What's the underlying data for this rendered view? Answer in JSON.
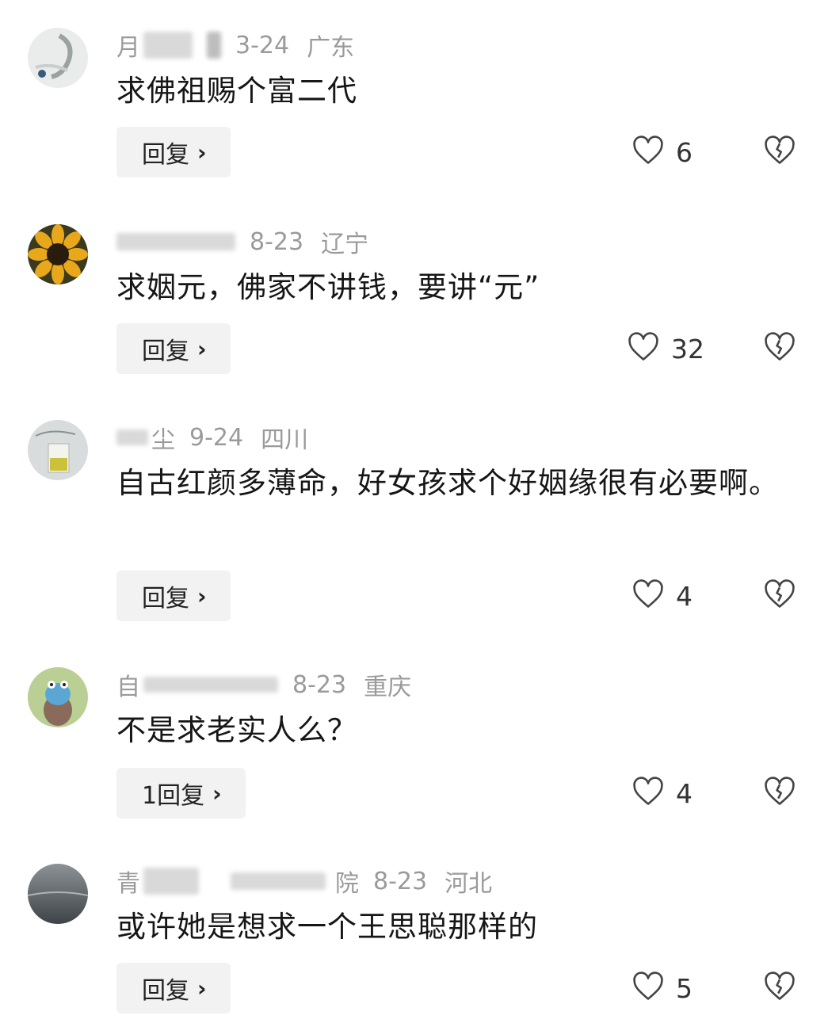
{
  "comments": [
    {
      "username": "月",
      "date": "3-24",
      "location": "广东",
      "text": "求佛祖赐个富二代",
      "reply_label": "回复",
      "likes": "6"
    },
    {
      "username": "",
      "date": "8-23",
      "location": "辽宁",
      "text": "求姻元，佛家不讲钱，要讲“元”",
      "reply_label": "回复",
      "likes": "32"
    },
    {
      "username": "尘",
      "date": "9-24",
      "location": "四川",
      "text": "自古红颜多薄命，好女孩求个好姻缘很有必要啊。",
      "reply_label": "回复",
      "likes": "4"
    },
    {
      "username": "自",
      "date": "8-23",
      "location": "重庆",
      "text": "不是求老实人么？",
      "reply_label": "1回复",
      "likes": "4"
    },
    {
      "username": "青",
      "username_tail": "院",
      "date": "8-23",
      "location": "河北",
      "text": "或许她是想求一个王思聪那样的",
      "reply_label": "回复",
      "likes": "5"
    }
  ],
  "icons": {
    "like": "heart-outline-icon",
    "dislike": "broken-heart-icon",
    "reply_chevron": "chevron-right-icon"
  }
}
